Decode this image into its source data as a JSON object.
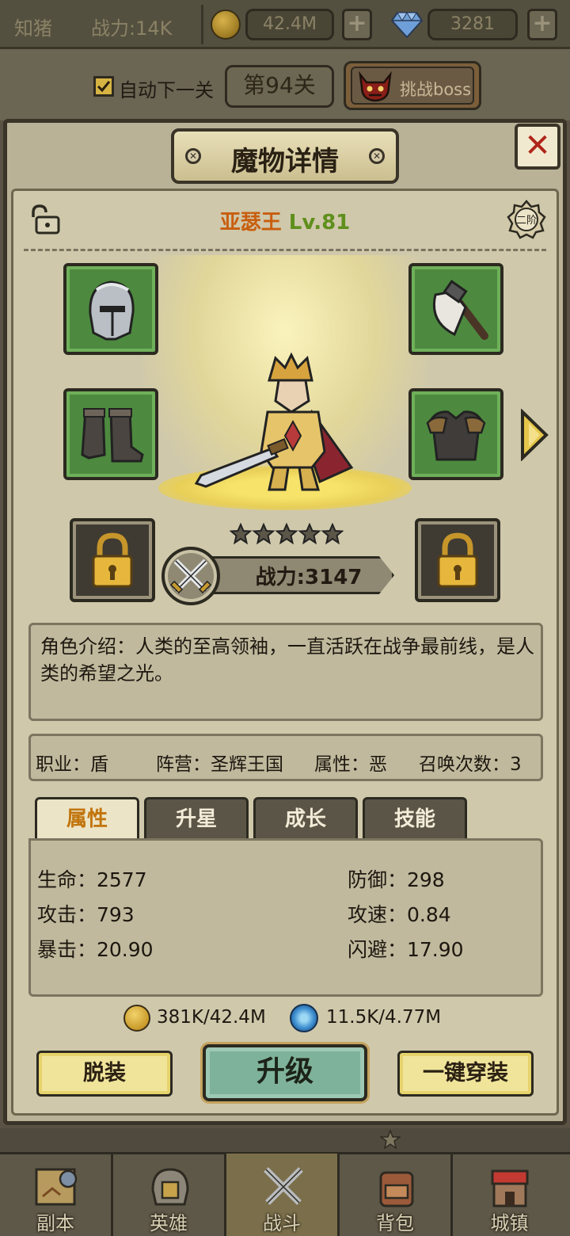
{
  "topbar": {
    "player_name": "知猪",
    "power": "战力:14K",
    "coins": "42.4M",
    "gems": "3281",
    "plus": "+"
  },
  "stage": {
    "auto_next_label": "自动下一关",
    "auto_next_checked": true,
    "stage_label": "第94关",
    "boss_label": "挑战boss"
  },
  "panel": {
    "title": "魔物详情",
    "close": "✕",
    "hero_name": "亚瑟王",
    "hero_level": "Lv.81",
    "rank": "二阶",
    "stars": 5,
    "power": "战力:3147",
    "description": "角色介绍：人类的至高领袖，一直活跃在战争最前线，是人类的希望之光。",
    "info": {
      "class": "职业：盾",
      "faction": "阵营：圣辉王国",
      "attribute": "属性：恶",
      "summons": "召唤次数：3"
    },
    "tabs": [
      "属性",
      "升星",
      "成长",
      "技能"
    ],
    "stats": {
      "hp": "生命：2577",
      "defense": "防御：298",
      "attack": "攻击：793",
      "attack_speed": "攻速：0.84",
      "crit": "暴击：20.90",
      "dodge": "闪避：17.90"
    },
    "resources": {
      "gold": "381K/42.4M",
      "essence": "11.5K/4.77M"
    },
    "buttons": {
      "unequip": "脱装",
      "upgrade": "升级",
      "auto_equip": "一键穿装"
    }
  },
  "nav": [
    {
      "label": "副本",
      "icon": "map-scroll-icon"
    },
    {
      "label": "英雄",
      "icon": "helmet-icon"
    },
    {
      "label": "战斗",
      "icon": "crossed-swords-icon"
    },
    {
      "label": "背包",
      "icon": "backpack-icon"
    },
    {
      "label": "城镇",
      "icon": "town-icon"
    }
  ],
  "colors": {
    "name_orange": "#c85e0e",
    "level_green": "#5f8f1c",
    "active_tab_text": "#c1740c",
    "close_red": "#b02418"
  }
}
